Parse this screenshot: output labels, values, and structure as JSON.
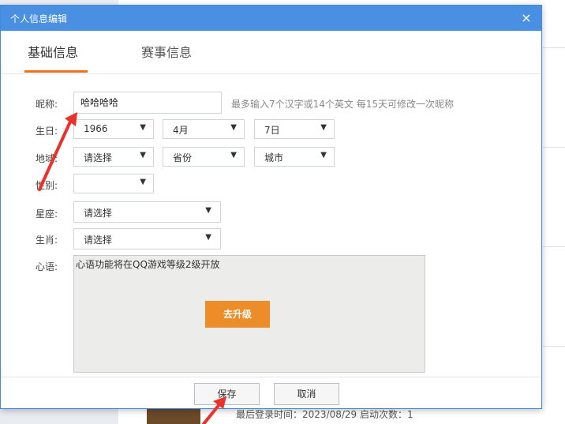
{
  "background": {
    "login_text": "最后登录时间：2023/08/29 启动次数：1"
  },
  "dialog": {
    "title": "个人信息编辑",
    "close_glyph": "×",
    "tabs": [
      {
        "label": "基础信息",
        "active": true
      },
      {
        "label": "赛事信息",
        "active": false
      }
    ]
  },
  "form": {
    "nickname": {
      "label": "昵称:",
      "value": "哈哈哈哈",
      "hint": "最多输入7个汉字或14个英文 每15天可修改一次昵称"
    },
    "birthday": {
      "label": "生日:",
      "year": "1966",
      "month": "4月",
      "day": "7日"
    },
    "region": {
      "label": "地域:",
      "country": "请选择",
      "province": "省份",
      "city": "城市"
    },
    "gender": {
      "label": "性别:",
      "value": ""
    },
    "constellation": {
      "label": "星座:",
      "value": "请选择"
    },
    "zodiac": {
      "label": "生肖:",
      "value": "请选择"
    },
    "heart": {
      "label": "心语:",
      "placeholder": "心语功能将在QQ游戏等级2级开放",
      "upgrade_label": "去升级"
    }
  },
  "footer": {
    "save_label": "保存",
    "cancel_label": "取消"
  },
  "colors": {
    "titlebar": "#4a90e2",
    "accent": "#e8731f",
    "upgrade": "#ec8d2a",
    "annotation": "#e8322b"
  },
  "icons": {
    "dropdown": "chevron-down-icon",
    "close": "close-icon",
    "annotation": "red-arrow-icon"
  }
}
